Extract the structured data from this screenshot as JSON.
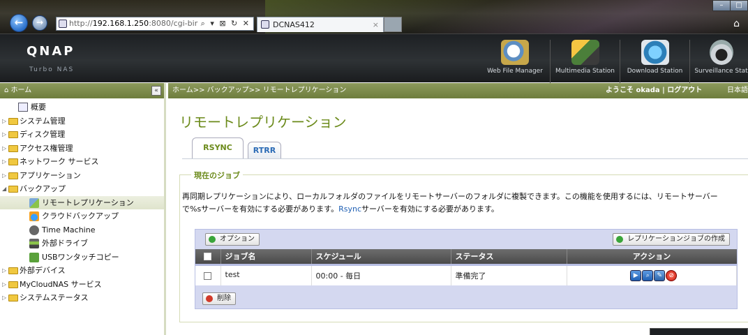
{
  "browser": {
    "url_prefix": "http://",
    "url_host": "192.168.1.250",
    "url_rest": ":8080/cgi-bir",
    "url_controls": "⌕ ▾ ⊠ ↻ ✕",
    "tab_title": "DCNAS412",
    "tab_close": "×"
  },
  "header": {
    "brand": "QNAP",
    "brand_sub": "Turbo NAS",
    "stations": [
      {
        "label": "Web File Manager"
      },
      {
        "label": "Multimedia Station"
      },
      {
        "label": "Download Station"
      },
      {
        "label": "Surveillance Stat"
      }
    ]
  },
  "sidebar": {
    "title": "ホーム",
    "items": [
      {
        "label": "概要"
      },
      {
        "label": "システム管理"
      },
      {
        "label": "ディスク管理"
      },
      {
        "label": "アクセス権管理"
      },
      {
        "label": "ネットワーク サービス"
      },
      {
        "label": "アプリケーション"
      },
      {
        "label": "バックアップ"
      },
      {
        "label": "リモートレプリケーション"
      },
      {
        "label": "クラウドバックアップ"
      },
      {
        "label": "Time Machine"
      },
      {
        "label": "外部ドライブ"
      },
      {
        "label": "USBワンタッチコピー"
      },
      {
        "label": "外部デバイス"
      },
      {
        "label": "MyCloudNAS サービス"
      },
      {
        "label": "システムステータス"
      }
    ]
  },
  "main": {
    "breadcrumb": "ホーム>> バックアップ>> リモートレプリケーション",
    "welcome": "ようこそ okada | ログアウト",
    "language": "日本語",
    "page_title": "リモートレプリケーション",
    "tabs": [
      {
        "label": "RSYNC"
      },
      {
        "label": "RTRR"
      }
    ],
    "jobs": {
      "legend": "現在のジョブ",
      "desc_part1": "再同期レプリケーションにより、ローカルフォルダのファイルをリモートサーバーのフォルダに複製できます。この機能を使用するには、リモートサーバーで%sサーバーを有効にする必要があります。",
      "desc_link": "Rsync",
      "desc_part2": "サーバーを有効にする必要があります。",
      "options_button": "オプション",
      "create_button": "レプリケーションジョブの作成",
      "delete_button": "削除",
      "columns": [
        "ジョブ名",
        "スケジュール",
        "ステータス",
        "アクション"
      ],
      "rows": [
        {
          "name": "test",
          "schedule": "00:00 - 毎日",
          "status": "準備完了"
        }
      ]
    }
  },
  "colors": {
    "accent": "#6b8a1a",
    "link": "#1f5fb3",
    "header_bar": "#7a8a46"
  }
}
